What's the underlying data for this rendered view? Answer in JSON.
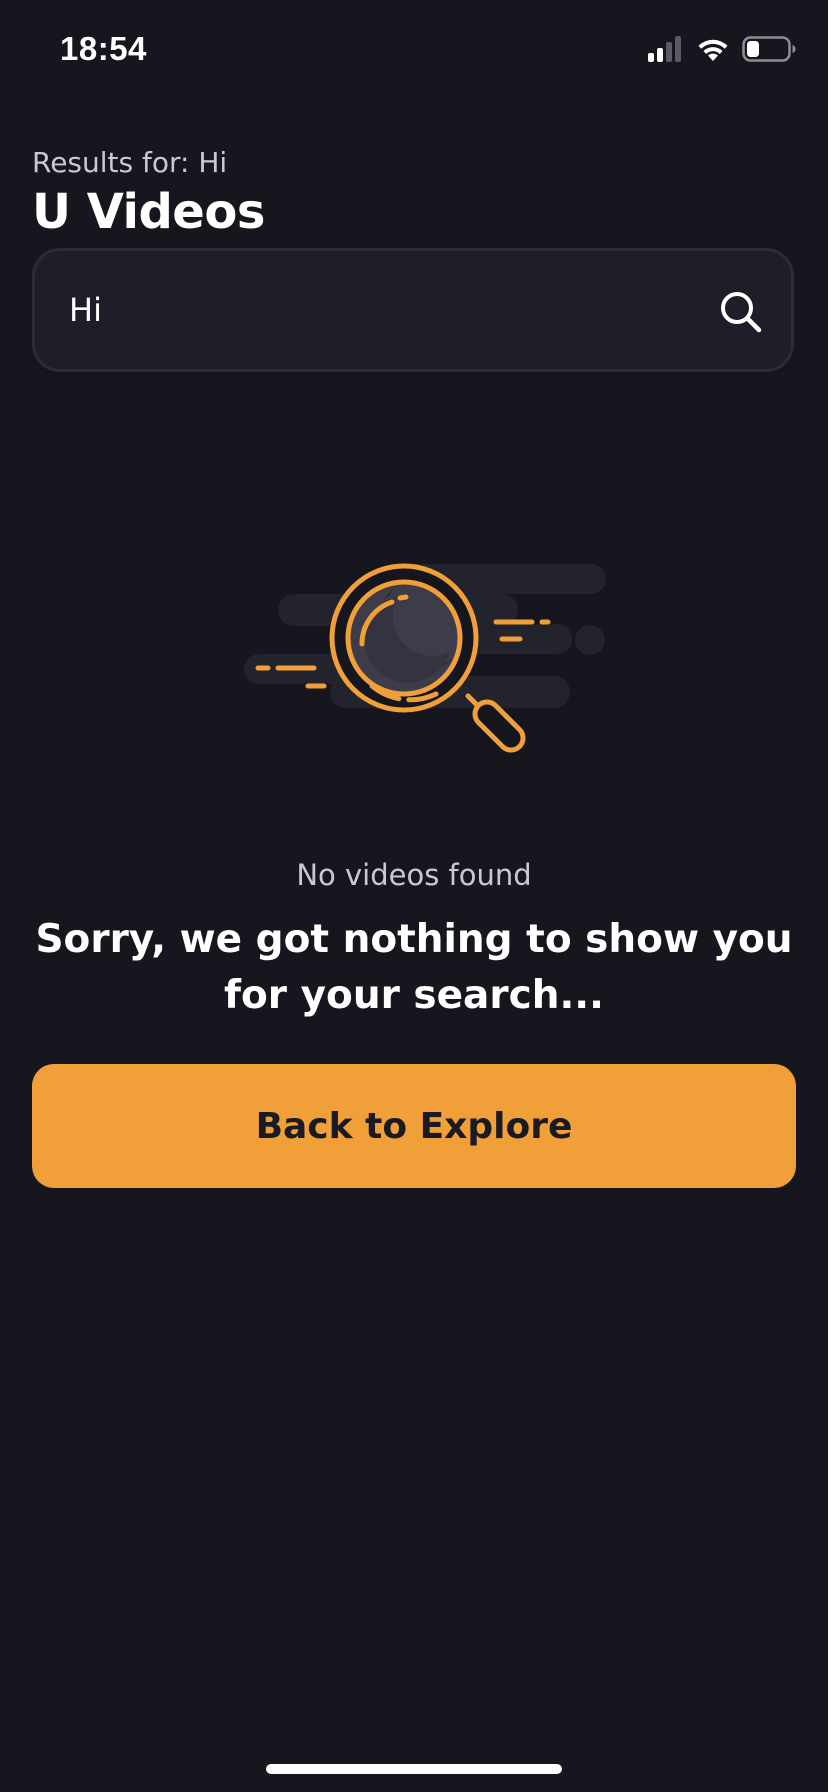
{
  "status_bar": {
    "time": "18:54",
    "icons": [
      "cellular-signal-icon",
      "wifi-icon",
      "battery-icon"
    ],
    "signal_bars_active": 2,
    "battery_level_fraction": 0.25
  },
  "header": {
    "results_prefix": "Results for: ",
    "query": "Hi",
    "title": "U Videos"
  },
  "search": {
    "value": "Hi",
    "icon": "search-icon"
  },
  "empty_state": {
    "illustration": "magnifying-glass-illustration",
    "subtitle": "No videos found",
    "message": "Sorry, we got nothing to show you for your search..."
  },
  "actions": {
    "back_to_explore_label": "Back to Explore"
  },
  "colors": {
    "background": "#16161f",
    "accent": "#f19f38",
    "input_background": "#1e1e29",
    "input_border": "#2c2c38",
    "muted_text": "#c9c8d6"
  }
}
